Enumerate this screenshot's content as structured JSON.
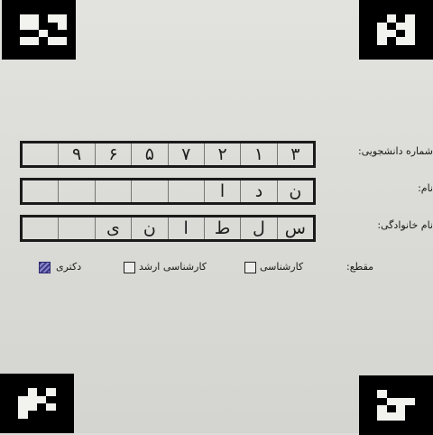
{
  "form": {
    "student_id": {
      "label": "شماره دانشجویی:",
      "cells": [
        "",
        "۹",
        "۶",
        "۵",
        "۷",
        "۲",
        "۱",
        "۳"
      ]
    },
    "first_name": {
      "label": "نام:",
      "cells": [
        "",
        "",
        "",
        "",
        "",
        "ا",
        "د",
        "ن"
      ]
    },
    "last_name": {
      "label": "نام خانوادگی:",
      "cells": [
        "",
        "",
        "ی",
        "ن",
        "ا",
        "ط",
        "ل",
        "س"
      ]
    },
    "degree": {
      "label": "مقطع:",
      "options": [
        {
          "label": "کارشناسی",
          "checked": false
        },
        {
          "label": "کارشناسی ارشد",
          "checked": false
        },
        {
          "label": "دکتری",
          "checked": true
        }
      ]
    }
  },
  "colors": {
    "checked_box": "#3d3a8a",
    "ink": "#1d1d1d",
    "paper": "#dcdcd8"
  }
}
